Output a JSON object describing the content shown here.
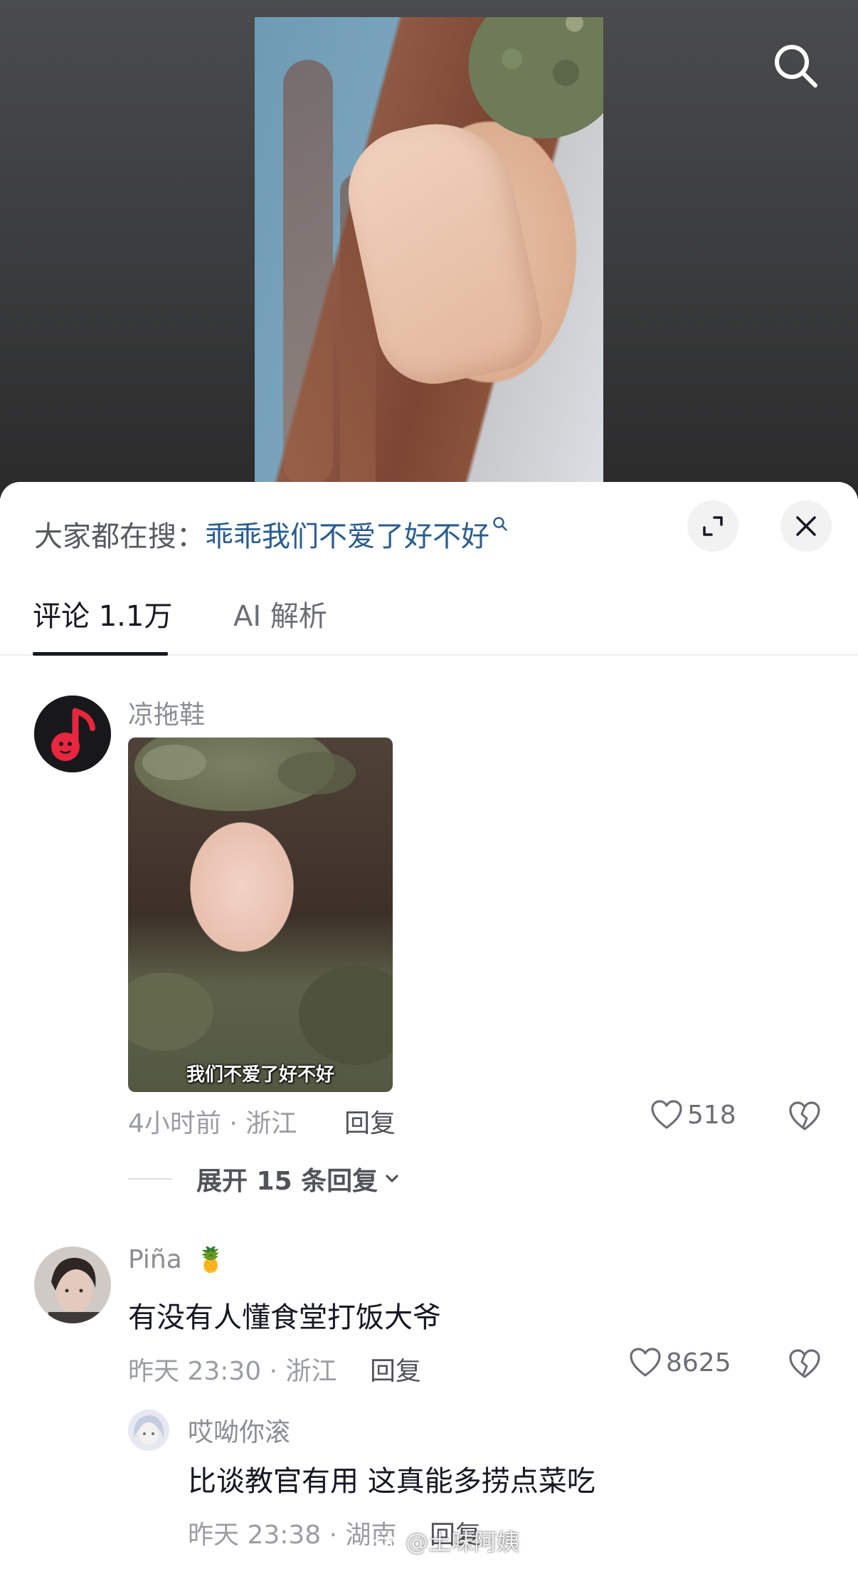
{
  "header": {
    "search_prefix": "大家都在搜：",
    "search_query": "乖乖我们不爱了好不好"
  },
  "tabs": [
    {
      "label": "评论 1.1万",
      "active": true
    },
    {
      "label": "AI 解析",
      "active": false
    }
  ],
  "comments": [
    {
      "username": "凉拖鞋",
      "sticker_caption": "我们不爱了好不好",
      "meta": "4小时前 · 浙江",
      "reply_label": "回复",
      "likes": "518",
      "expand_label": "展开 15 条回复"
    },
    {
      "username": "Piña",
      "username_emoji": "🍍",
      "text": "有没有人懂食堂打饭大爷",
      "meta": "昨天 23:30 · 浙江",
      "reply_label": "回复",
      "likes": "8625",
      "replies": [
        {
          "username": "哎呦你滚",
          "text": "比谈教官有用 这真能多捞点菜吃",
          "meta": "昨天 23:38 · 湖南",
          "reply_label": "回复"
        }
      ]
    }
  ],
  "watermark": "@土味阿姨",
  "colors": {
    "link_blue": "#2a5d8f",
    "text_primary": "#161823",
    "text_secondary": "#8a8d91"
  }
}
